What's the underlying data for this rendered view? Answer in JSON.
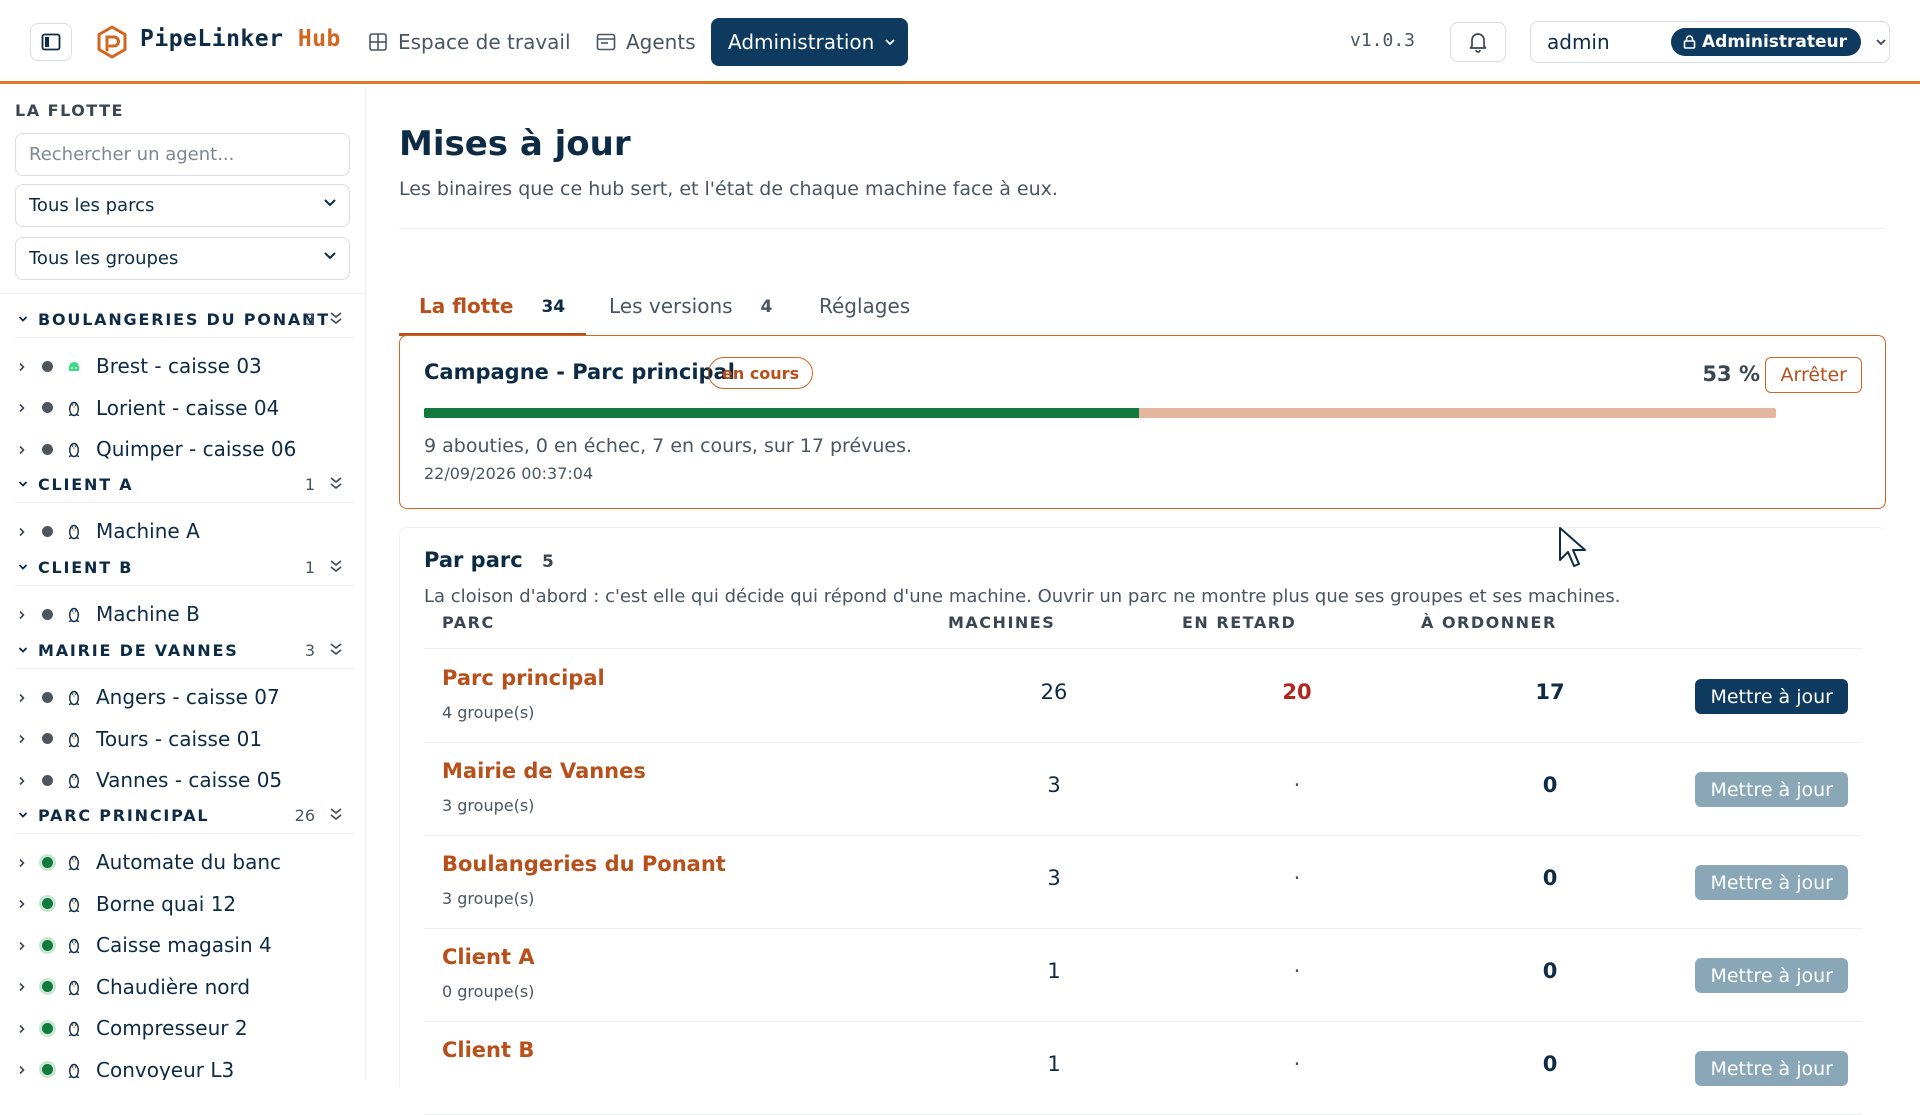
{
  "header": {
    "brand": "PipeLinker",
    "brand_suffix": "Hub",
    "nav": [
      "Espace de travail",
      "Agents",
      "Administration"
    ],
    "version": "v1.0.3",
    "user": "admin",
    "role": "Administrateur"
  },
  "sidebar": {
    "title": "LA FLOTTE",
    "search_placeholder": "Rechercher un agent...",
    "park_filter": "Tous les parcs",
    "group_filter": "Tous les groupes",
    "groups": [
      {
        "name": "BOULANGERIES DU PONANT",
        "count": "3",
        "agents": [
          {
            "name": "Brest - caisse 03",
            "status": "offline",
            "os": "android-icon"
          },
          {
            "name": "Lorient - caisse 04",
            "status": "offline",
            "os": "linux-icon"
          },
          {
            "name": "Quimper - caisse 06",
            "status": "offline",
            "os": "linux-icon"
          }
        ]
      },
      {
        "name": "CLIENT A",
        "count": "1",
        "agents": [
          {
            "name": "Machine A",
            "status": "offline",
            "os": "linux-icon"
          }
        ]
      },
      {
        "name": "CLIENT B",
        "count": "1",
        "agents": [
          {
            "name": "Machine B",
            "status": "offline",
            "os": "linux-icon"
          }
        ]
      },
      {
        "name": "MAIRIE DE VANNES",
        "count": "3",
        "agents": [
          {
            "name": "Angers - caisse 07",
            "status": "offline",
            "os": "linux-icon"
          },
          {
            "name": "Tours - caisse 01",
            "status": "offline",
            "os": "linux-icon"
          },
          {
            "name": "Vannes - caisse 05",
            "status": "offline",
            "os": "linux-icon"
          }
        ]
      },
      {
        "name": "PARC PRINCIPAL",
        "count": "26",
        "agents": [
          {
            "name": "Automate du banc",
            "status": "online",
            "os": "linux-icon"
          },
          {
            "name": "Borne quai 12",
            "status": "online",
            "os": "linux-icon"
          },
          {
            "name": "Caisse magasin 4",
            "status": "online",
            "os": "linux-icon"
          },
          {
            "name": "Chaudière nord",
            "status": "online",
            "os": "linux-icon"
          },
          {
            "name": "Compresseur 2",
            "status": "online",
            "os": "linux-icon"
          },
          {
            "name": "Convoyeur L3",
            "status": "online",
            "os": "linux-icon"
          }
        ]
      }
    ]
  },
  "main": {
    "title": "Mises à jour",
    "subtitle": "Les binaires que ce hub sert, et l'état de chaque machine face à eux.",
    "tabs": [
      {
        "label": "La flotte",
        "count": "34"
      },
      {
        "label": "Les versions",
        "count": "4"
      },
      {
        "label": "Réglages",
        "count": ""
      }
    ],
    "campaign": {
      "title": "Campagne - Parc principal",
      "status": "en cours",
      "percent_label": "53 %",
      "progress": 0.53,
      "stop_label": "Arrêter",
      "summary": "9 abouties, 0 en échec, 7 en cours, sur 17 prévues.",
      "date": "22/09/2026 00:37:04"
    },
    "parks": {
      "title": "Par parc",
      "count": "5",
      "description": "La cloison d'abord : c'est elle qui décide qui répond d'une machine. Ouvrir un parc ne montre plus que ses groupes et ses machines.",
      "headers": {
        "park": "PARC",
        "machines": "MACHINES",
        "late": "EN RETARD",
        "order": "À ORDONNER"
      },
      "button_label": "Mettre à jour",
      "rows": [
        {
          "name": "Parc principal",
          "groups": "4 groupe(s)",
          "machines": "26",
          "late": "20",
          "order": "17",
          "enabled": true
        },
        {
          "name": "Mairie de Vannes",
          "groups": "3 groupe(s)",
          "machines": "3",
          "late": "·",
          "order": "0",
          "enabled": false
        },
        {
          "name": "Boulangeries du Ponant",
          "groups": "3 groupe(s)",
          "machines": "3",
          "late": "·",
          "order": "0",
          "enabled": false
        },
        {
          "name": "Client A",
          "groups": "0 groupe(s)",
          "machines": "1",
          "late": "·",
          "order": "0",
          "enabled": false
        },
        {
          "name": "Client B",
          "groups": "",
          "machines": "1",
          "late": "·",
          "order": "0",
          "enabled": false
        }
      ]
    }
  },
  "colors": {
    "accent": "#d2651f",
    "navy": "#0d3a5e",
    "online": "#137a3d",
    "late": "#b3261e"
  }
}
